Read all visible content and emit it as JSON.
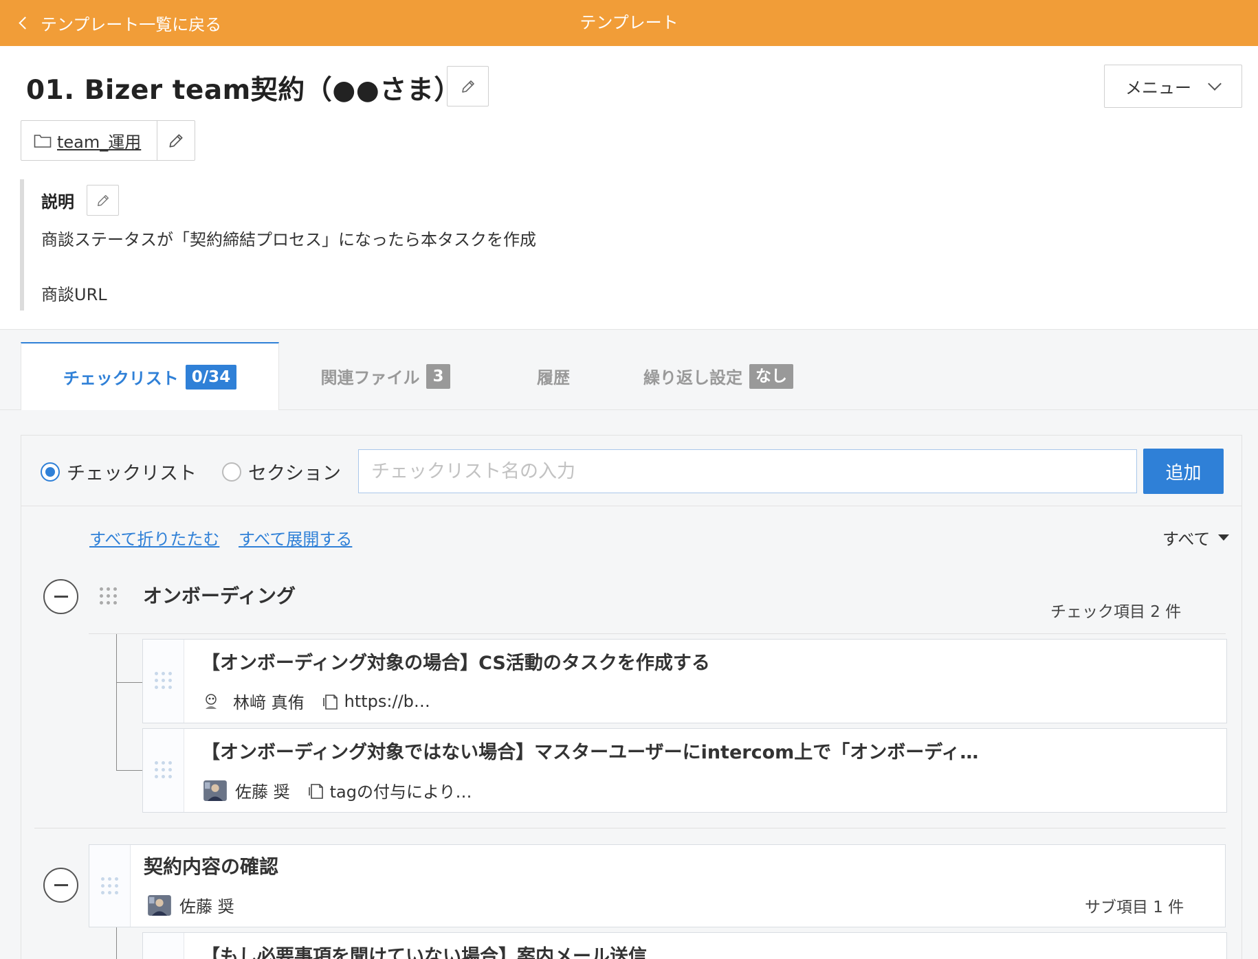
{
  "header": {
    "back_label": "テンプレート一覧に戻る",
    "title": "テンプレート",
    "bg_color": "#f19d38"
  },
  "template": {
    "title": "01. Bizer team契約（●●さま）",
    "menu_label": "メニュー",
    "folder_label": "team_運用"
  },
  "description": {
    "label": "説明",
    "line1": "商談ステータスが「契約締結プロセス」になったら本タスクを作成",
    "line2": "商談URL"
  },
  "tabs": [
    {
      "label": "チェックリスト",
      "badge": "0/34",
      "active": true
    },
    {
      "label": "関連ファイル",
      "badge": "3",
      "active": false
    },
    {
      "label": "履歴",
      "badge": "",
      "active": false
    },
    {
      "label": "繰り返し設定",
      "badge": "なし",
      "active": false
    }
  ],
  "add_form": {
    "radio_checklist": "チェックリスト",
    "radio_section": "セクション",
    "selected": "checklist",
    "placeholder": "チェックリスト名の入力",
    "add_button": "追加"
  },
  "controls": {
    "collapse_all": "すべて折りたたむ",
    "expand_all": "すべて展開する",
    "filter": "すべて"
  },
  "sections": [
    {
      "title": "オンボーディング",
      "count_label": "チェック項目 2 件",
      "items": [
        {
          "title": "【オンボーディング対象の場合】CS活動のタスクを作成する",
          "assignee": "林﨑 真侑",
          "note": "https://b…"
        },
        {
          "title": "【オンボーディング対象ではない場合】マスターユーザーにintercom上で「オンボーディ…",
          "assignee": "佐藤 奨",
          "note": "tagの付与により…"
        }
      ]
    },
    {
      "title": "契約内容の確認",
      "assignee": "佐藤 奨",
      "count_label": "サブ項目 1 件",
      "items": [
        {
          "title": "【もし必要事項を聞けていない場合】案内メール送信"
        }
      ]
    }
  ],
  "colors": {
    "accent": "#2f80d7",
    "header": "#f19d38",
    "badge_inactive": "#999999"
  }
}
